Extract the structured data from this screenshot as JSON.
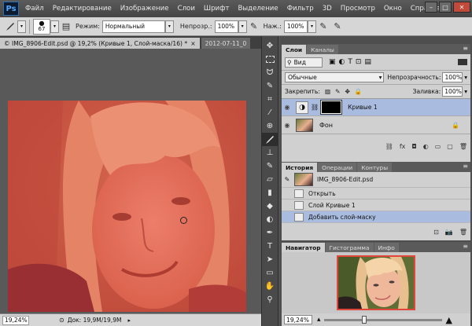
{
  "menubar": {
    "logo": "Ps",
    "items": [
      "Файл",
      "Редактирование",
      "Изображение",
      "Слои",
      "Шрифт",
      "Выделение",
      "Фильтр",
      "3D",
      "Просмотр",
      "Окно",
      "Справка"
    ]
  },
  "options": {
    "brush_size": "67",
    "mode_label": "Режим:",
    "mode_value": "Нормальный",
    "opacity_label": "Непрозр.:",
    "opacity_value": "100%",
    "flow_label": "Наж.:",
    "flow_value": "100%"
  },
  "doc_tabs": [
    {
      "label": "© IMG_8906-Edit.psd @ 19,2% (Кривые 1, Слой-маска/16) *",
      "close": "×"
    },
    {
      "label": "2012-07-11_0"
    }
  ],
  "status": {
    "zoom": "19,24%",
    "doc_info": "Док: 19,9M/19,9M"
  },
  "layers_panel": {
    "tabs": [
      "Слои",
      "Каналы"
    ],
    "kind_value": "Вид",
    "blend_value": "Обычные",
    "opacity_label": "Непрозрачность:",
    "opacity_value": "100%",
    "lock_label": "Закрепить:",
    "fill_label": "Заливка:",
    "fill_value": "100%",
    "layers": [
      {
        "name": "Кривые 1",
        "selected": true
      },
      {
        "name": "Фон",
        "selected": false
      }
    ]
  },
  "history_panel": {
    "tabs": [
      "История",
      "Операции",
      "Контуры"
    ],
    "snapshot": "IMG_8906-Edit.psd",
    "items": [
      {
        "label": "Открыть",
        "selected": false
      },
      {
        "label": "Слой Кривые 1",
        "selected": false
      },
      {
        "label": "Добавить слой-маску",
        "selected": true
      }
    ]
  },
  "navigator_panel": {
    "tabs": [
      "Навигатор",
      "Гистограмма",
      "Инфо"
    ],
    "zoom": "19,24%"
  },
  "colors": {
    "accent_selection": "#a9bce0",
    "mask_overlay": "#e04a3c",
    "nav_frame": "#e0473a"
  },
  "icons": [
    "brush-icon",
    "eye-icon",
    "lock-icon",
    "trash-icon",
    "camera-icon",
    "new-layer-icon",
    "link-icon",
    "fx-icon"
  ]
}
